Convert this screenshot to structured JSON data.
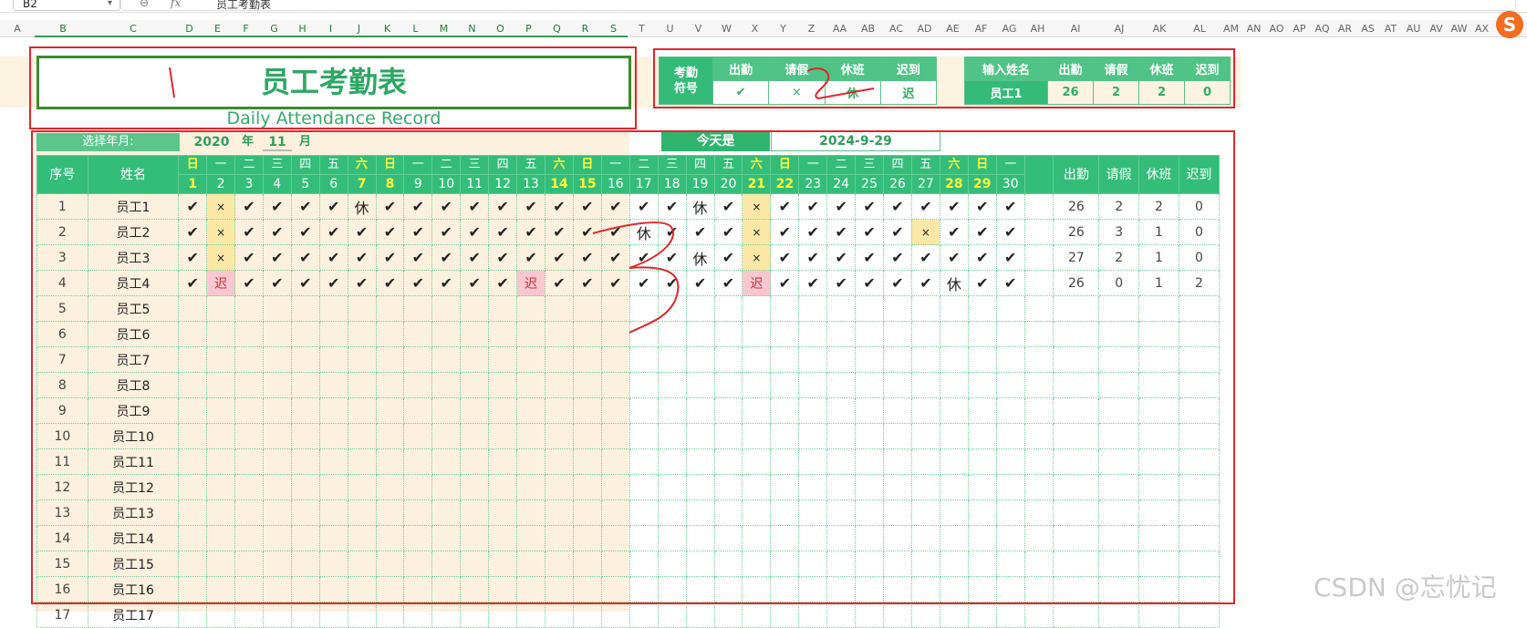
{
  "formula_bar": {
    "cell_ref": "B2",
    "zoom_icon": "zoom-icon",
    "fx": "fx",
    "value": "员工考勤表"
  },
  "column_headers": [
    "A",
    "B",
    "C",
    "D",
    "E",
    "F",
    "G",
    "H",
    "I",
    "J",
    "K",
    "L",
    "M",
    "N",
    "O",
    "P",
    "Q",
    "R",
    "S",
    "T",
    "U",
    "V",
    "W",
    "X",
    "Y",
    "Z",
    "AA",
    "AB",
    "AC",
    "AD",
    "AE",
    "AF",
    "AG",
    "AH",
    "AI",
    "AJ",
    "AK",
    "AL",
    "AM",
    "AN",
    "AO",
    "AP",
    "AQ",
    "AR",
    "AS",
    "AT",
    "AU",
    "AV",
    "AW",
    "AX"
  ],
  "title": "员工考勤表",
  "subtitle": "Daily Attendance Record",
  "legend": {
    "label": [
      "考勤",
      "符号"
    ],
    "headers": [
      "出勤",
      "请假",
      "休班",
      "迟到"
    ],
    "symbols": [
      "✔",
      "×",
      "休",
      "迟"
    ]
  },
  "lookup": {
    "label": "输入姓名",
    "headers": [
      "出勤",
      "请假",
      "休班",
      "迟到"
    ],
    "name": "员工1",
    "values": [
      "26",
      "2",
      "2",
      "0"
    ]
  },
  "select": {
    "label": "选择年月:",
    "year": "2020",
    "year_unit": "年",
    "month": "11",
    "month_unit": "月"
  },
  "today": {
    "label": "今天是",
    "value": "2024-9-29"
  },
  "grid": {
    "h_no": "序号",
    "h_name": "姓名",
    "weekdays": [
      "日",
      "一",
      "二",
      "三",
      "四",
      "五",
      "六",
      "日",
      "一",
      "二",
      "三",
      "四",
      "五",
      "六",
      "日",
      "一",
      "二",
      "三",
      "四",
      "五",
      "六",
      "日",
      "一",
      "二",
      "三",
      "四",
      "五",
      "六",
      "日",
      "一"
    ],
    "days": [
      "1",
      "2",
      "3",
      "4",
      "5",
      "6",
      "7",
      "8",
      "9",
      "10",
      "11",
      "12",
      "13",
      "14",
      "15",
      "16",
      "17",
      "18",
      "19",
      "20",
      "21",
      "22",
      "23",
      "24",
      "25",
      "26",
      "27",
      "28",
      "29",
      "30"
    ],
    "summary_headers": [
      "出勤",
      "请假",
      "休班",
      "迟到"
    ],
    "rows": [
      {
        "no": "1",
        "name": "员工1",
        "marks": [
          "✔",
          "×",
          "✔",
          "✔",
          "✔",
          "✔",
          "休",
          "✔",
          "✔",
          "✔",
          "✔",
          "✔",
          "✔",
          "✔",
          "✔",
          "✔",
          "✔",
          "✔",
          "休",
          "✔",
          "×",
          "✔",
          "✔",
          "✔",
          "✔",
          "✔",
          "✔",
          "✔",
          "✔",
          "✔"
        ],
        "totals": [
          "26",
          "2",
          "2",
          "0"
        ]
      },
      {
        "no": "2",
        "name": "员工2",
        "marks": [
          "✔",
          "×",
          "✔",
          "✔",
          "✔",
          "✔",
          "✔",
          "✔",
          "✔",
          "✔",
          "✔",
          "✔",
          "✔",
          "✔",
          "✔",
          "✔",
          "休",
          "✔",
          "✔",
          "✔",
          "×",
          "✔",
          "✔",
          "✔",
          "✔",
          "✔",
          "×",
          "✔",
          "✔",
          "✔"
        ],
        "totals": [
          "26",
          "3",
          "1",
          "0"
        ]
      },
      {
        "no": "3",
        "name": "员工3",
        "marks": [
          "✔",
          "×",
          "✔",
          "✔",
          "✔",
          "✔",
          "✔",
          "✔",
          "✔",
          "✔",
          "✔",
          "✔",
          "✔",
          "✔",
          "✔",
          "✔",
          "✔",
          "✔",
          "休",
          "✔",
          "×",
          "✔",
          "✔",
          "✔",
          "✔",
          "✔",
          "✔",
          "✔",
          "✔",
          "✔"
        ],
        "totals": [
          "27",
          "2",
          "1",
          "0"
        ]
      },
      {
        "no": "4",
        "name": "员工4",
        "marks": [
          "✔",
          "迟",
          "✔",
          "✔",
          "✔",
          "✔",
          "✔",
          "✔",
          "✔",
          "✔",
          "✔",
          "✔",
          "迟",
          "✔",
          "✔",
          "✔",
          "✔",
          "✔",
          "✔",
          "✔",
          "迟",
          "✔",
          "✔",
          "✔",
          "✔",
          "✔",
          "✔",
          "休",
          "✔",
          "✔"
        ],
        "totals": [
          "26",
          "0",
          "1",
          "2"
        ]
      },
      {
        "no": "5",
        "name": "员工5",
        "marks": [],
        "totals": []
      },
      {
        "no": "6",
        "name": "员工6",
        "marks": [],
        "totals": []
      },
      {
        "no": "7",
        "name": "员工7",
        "marks": [],
        "totals": []
      },
      {
        "no": "8",
        "name": "员工8",
        "marks": [],
        "totals": []
      },
      {
        "no": "9",
        "name": "员工9",
        "marks": [],
        "totals": []
      },
      {
        "no": "10",
        "name": "员工10",
        "marks": [],
        "totals": []
      },
      {
        "no": "11",
        "name": "员工11",
        "marks": [],
        "totals": []
      },
      {
        "no": "12",
        "name": "员工12",
        "marks": [],
        "totals": []
      },
      {
        "no": "13",
        "name": "员工13",
        "marks": [],
        "totals": []
      },
      {
        "no": "14",
        "name": "员工14",
        "marks": [],
        "totals": []
      },
      {
        "no": "15",
        "name": "员工15",
        "marks": [],
        "totals": []
      },
      {
        "no": "16",
        "name": "员工16",
        "marks": [],
        "totals": []
      },
      {
        "no": "17",
        "name": "员工17",
        "marks": [],
        "totals": []
      }
    ]
  },
  "watermark": "CSDN @忘忧记",
  "colors": {
    "green": "#34bd79",
    "leave": "#fbe8a6",
    "late": "#f8c7cf",
    "weekend_text": "#fffa3a",
    "annotation": "#e0262a"
  }
}
